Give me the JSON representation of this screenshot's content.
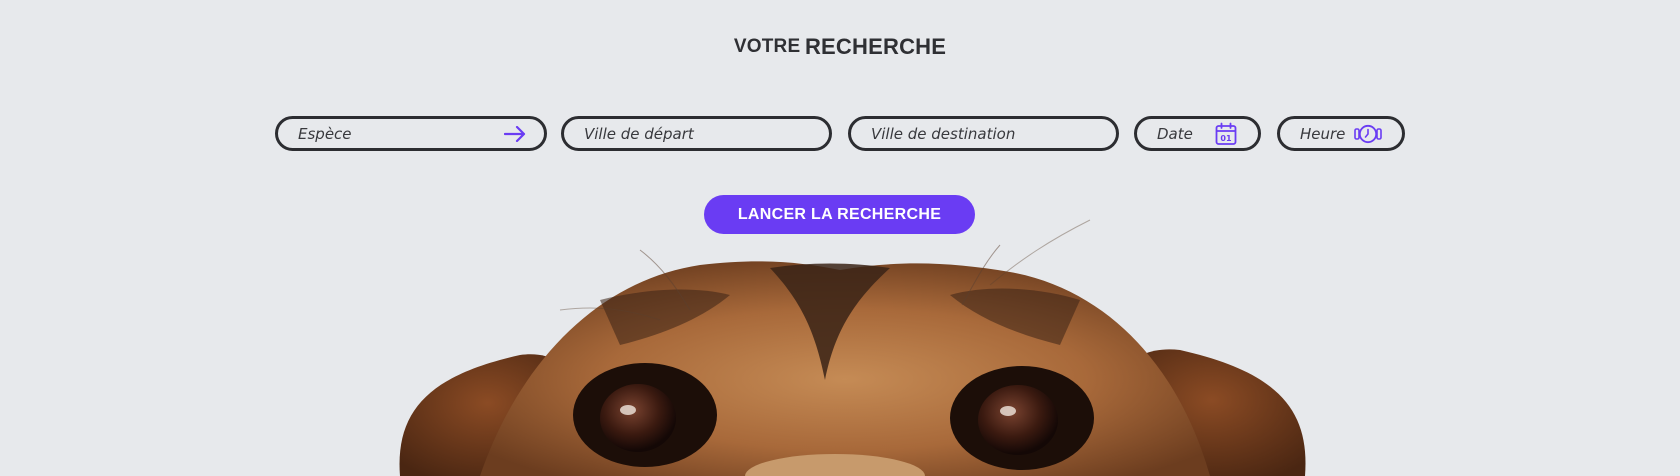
{
  "header": {
    "title_prefix": "VOTRE",
    "title_main": "RECHERCHE"
  },
  "fields": {
    "espece": {
      "placeholder": "Espèce",
      "icon": "arrow-right-icon"
    },
    "ville_depart": {
      "placeholder": "Ville de départ"
    },
    "ville_destination": {
      "placeholder": "Ville de destination"
    },
    "date": {
      "placeholder": "Date",
      "icon": "calendar-icon",
      "icon_text": "01"
    },
    "heure": {
      "placeholder": "Heure",
      "icon": "clock-icon"
    }
  },
  "search_button": {
    "label": "LANCER LA RECHERCHE"
  },
  "colors": {
    "accent": "#6a3cf3",
    "background": "#e7e9ec",
    "border": "#2c2d31",
    "text": "#2f3034"
  }
}
